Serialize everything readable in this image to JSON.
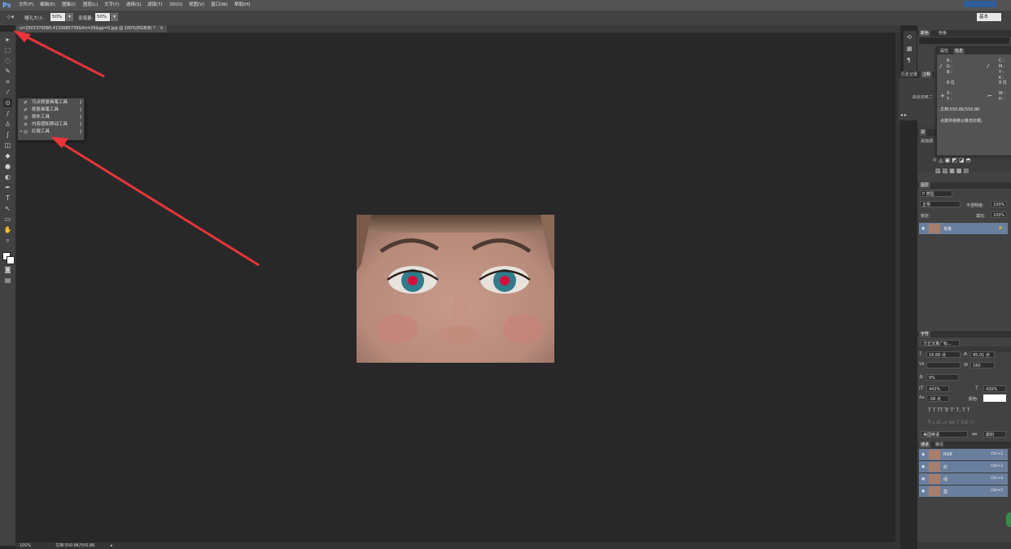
{
  "app": {
    "logo": "Ps"
  },
  "menubar": {
    "items": [
      "文件(F)",
      "编辑(E)",
      "图像(I)",
      "图层(L)",
      "文字(Y)",
      "选择(S)",
      "滤镜(T)",
      "3D(D)",
      "视图(V)",
      "窗口(W)",
      "帮助(H)"
    ]
  },
  "options": {
    "pupil_label": "瞳孔大小:",
    "pupil_value": "50%",
    "darken_label": "变暗量:",
    "darken_value": "50%",
    "workspace": "基本"
  },
  "document": {
    "tab_title": "u=2507370090,4133685739&fm=26&gp=0.jpg @ 100%(RGB/8) *",
    "close": "×"
  },
  "flyout": {
    "items": [
      {
        "label": "污点修复画笔工具",
        "shortcut": "J",
        "icon": "spot-healing-icon"
      },
      {
        "label": "修复画笔工具",
        "shortcut": "J",
        "icon": "healing-brush-icon"
      },
      {
        "label": "修补工具",
        "shortcut": "J",
        "icon": "patch-icon"
      },
      {
        "label": "内容感知移动工具",
        "shortcut": "J",
        "icon": "content-aware-move-icon"
      },
      {
        "label": "红眼工具",
        "shortcut": "J",
        "icon": "red-eye-icon",
        "selected": true
      }
    ]
  },
  "status": {
    "zoom": "100%",
    "doc": "文档:550.8K/550.8K"
  },
  "panels": {
    "top_tabs": [
      "颜色",
      "色板"
    ],
    "history_tabs": [
      "历史记录",
      "注释"
    ],
    "history_text": "来自效果二",
    "info_tabs": [
      "属性",
      "信息"
    ],
    "info": {
      "left_rgb": [
        "R :",
        "G :",
        "B :"
      ],
      "right_cmyk": [
        "C :",
        "M :",
        "Y :",
        "K :"
      ],
      "bit_left": "8 位",
      "bit_right": "8 位",
      "xy_left": [
        "X :",
        "Y :"
      ],
      "wh_right": [
        "W :",
        "H :"
      ],
      "doc": "文档:550.8K/550.8K",
      "hint": "点按并拖移以移去红眼。"
    },
    "adjust_tabs": [
      "调"
    ],
    "adjust_title": "添加调",
    "layers": {
      "tab": "图层",
      "kind": "P 类型",
      "blend": "正常",
      "opacity_label": "不透明度:",
      "opacity": "100%",
      "lock_label": "锁定:",
      "fill_label": "填充:",
      "fill": "100%",
      "layer_name": "背景"
    },
    "character": {
      "tab": "字符",
      "font": "方正汉真广标...",
      "size": "16.68 点",
      "leading": "95.01 点",
      "va_label": "VA",
      "tracking": "160",
      "scale_label": "0%",
      "v_scale": "442%",
      "h_scale": "430%",
      "baseline": "-38 点",
      "color_label": "颜色:",
      "styles": "T  T  TT  Tr  T'  T,  T  T",
      "language": "美国英语",
      "aa_label": "aa",
      "aa_mode": "犀利"
    },
    "channels": {
      "tabs": [
        "通道",
        "路径"
      ],
      "rows": [
        {
          "name": "RGB",
          "shortcut": "Ctrl+2"
        },
        {
          "name": "红",
          "shortcut": "Ctrl+3"
        },
        {
          "name": "绿",
          "shortcut": "Ctrl+4"
        },
        {
          "name": "蓝",
          "shortcut": "Ctrl+5"
        }
      ]
    }
  },
  "colors": {
    "arrow": "#e8343a",
    "accent": "#6a7f9e"
  }
}
